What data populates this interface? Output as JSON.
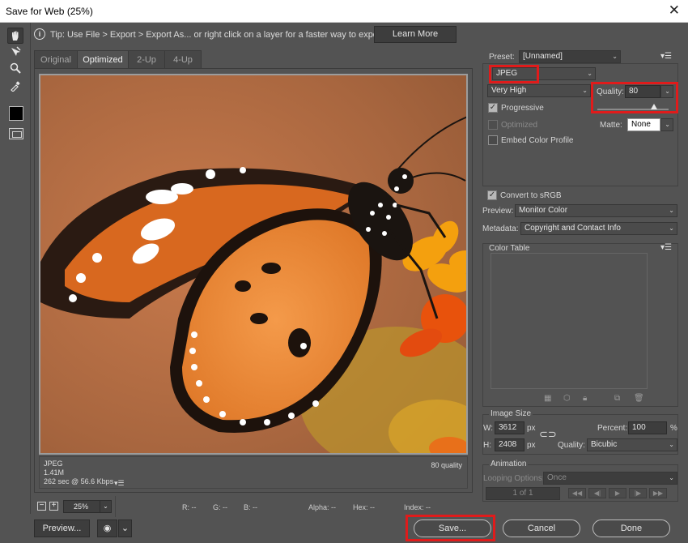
{
  "window": {
    "title": "Save for Web (25%)",
    "close_glyph": "✕"
  },
  "tools": [
    "hand-icon",
    "slice-select-icon",
    "zoom-icon",
    "eyedropper-icon"
  ],
  "tip": {
    "text": "Tip: Use File > Export > Export As...  or right click on a layer for a faster way to export assets",
    "button": "Learn More"
  },
  "tabs": [
    "Original",
    "Optimized",
    "2-Up",
    "4-Up"
  ],
  "image_info": {
    "format": "JPEG",
    "size": "1.41M",
    "time": "262 sec @ 56.6 Kbps",
    "quality": "80 quality"
  },
  "status": {
    "zoom": "25%",
    "r": "R: --",
    "g": "G: --",
    "b": "B: --",
    "alpha": "Alpha: --",
    "hex": "Hex: --",
    "index": "Index: --"
  },
  "buttons": {
    "preview": "Preview...",
    "save": "Save...",
    "cancel": "Cancel",
    "done": "Done"
  },
  "settings": {
    "preset_label": "Preset:",
    "preset": "[Unnamed]",
    "format": "JPEG",
    "compression": "Very High",
    "quality_label": "Quality:",
    "quality": "80",
    "quality_fraction": 0.8,
    "progressive": "Progressive",
    "optimized": "Optimized",
    "matte_label": "Matte:",
    "matte": "None",
    "embed_profile": "Embed Color Profile",
    "convert_srgb": "Convert to sRGB",
    "preview_label": "Preview:",
    "preview_value": "Monitor Color",
    "metadata_label": "Metadata:",
    "metadata_value": "Copyright and Contact Info"
  },
  "color_table": {
    "title": "Color Table"
  },
  "image_size": {
    "title": "Image Size",
    "w_label": "W:",
    "w": "3612",
    "h_label": "H:",
    "h": "2408",
    "unit": "px",
    "percent_label": "Percent:",
    "percent": "100",
    "percent_unit": "%",
    "quality_label": "Quality:",
    "quality": "Bicubic"
  },
  "animation": {
    "title": "Animation",
    "looping_label": "Looping Options:",
    "looping": "Once",
    "frame": "1 of 1"
  },
  "colors": {
    "highlight": "#e01b1b",
    "background": "#535353"
  }
}
